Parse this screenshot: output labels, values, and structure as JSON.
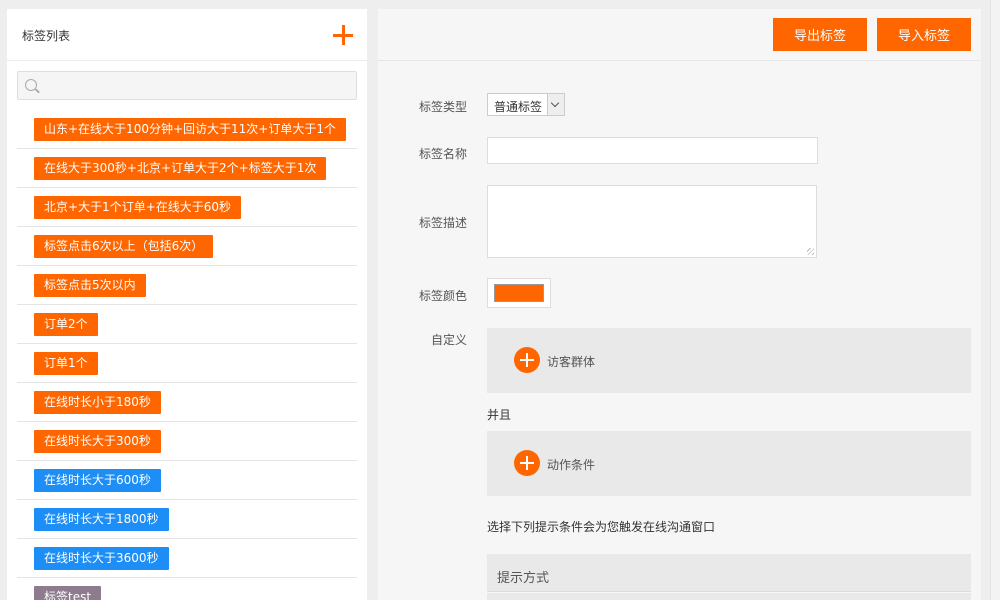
{
  "left": {
    "title": "标签列表",
    "search_placeholder": "",
    "tags": [
      {
        "label": "山东+在线大于100分钟+回访大于11次+订单大于1个",
        "color": "#ff6600"
      },
      {
        "label": "在线大于300秒+北京+订单大于2个+标签大于1次",
        "color": "#ff6600"
      },
      {
        "label": "北京+大于1个订单+在线大于60秒",
        "color": "#ff6600"
      },
      {
        "label": "标签点击6次以上（包括6次）",
        "color": "#ff6600"
      },
      {
        "label": "标签点击5次以内",
        "color": "#ff6600"
      },
      {
        "label": "订单2个",
        "color": "#ff6600"
      },
      {
        "label": "订单1个",
        "color": "#ff6600"
      },
      {
        "label": "在线时长小于180秒",
        "color": "#ff6600"
      },
      {
        "label": "在线时长大于300秒",
        "color": "#ff6600"
      },
      {
        "label": "在线时长大于600秒",
        "color": "#1e8ef7"
      },
      {
        "label": "在线时长大于1800秒",
        "color": "#1e8ef7"
      },
      {
        "label": "在线时长大于3600秒",
        "color": "#1e8ef7"
      },
      {
        "label": "标签test",
        "color": "#8e7c8e"
      }
    ]
  },
  "toolbar": {
    "export_label": "导出标签",
    "import_label": "导入标签"
  },
  "form": {
    "type_label": "标签类型",
    "type_value": "普通标签",
    "name_label": "标签名称",
    "desc_label": "标签描述",
    "color_label": "标签颜色",
    "color_value": "#ff6600",
    "custom_label": "自定义",
    "visitor_group": "访客群体",
    "and_text": "并且",
    "action_condition": "动作条件",
    "hint_text": "选择下列提示条件会为您触发在线沟通窗口",
    "prompt_method": "提示方式"
  }
}
